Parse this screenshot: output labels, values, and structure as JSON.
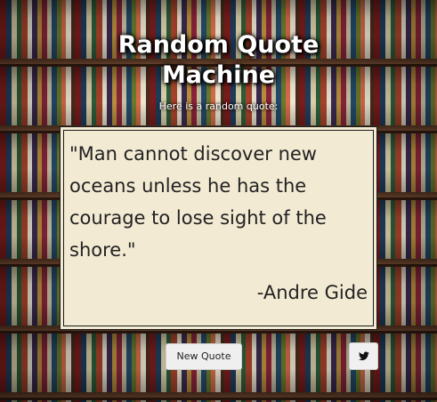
{
  "app": {
    "title_line1": "Random Quote",
    "title_line2": "Machine",
    "subtitle": "Here is a random quote:"
  },
  "quote": {
    "text": "\"Man cannot discover new oceans unless he has the courage to lose sight of the shore.\"",
    "author": "-Andre Gide"
  },
  "actions": {
    "new_quote_label": "New Quote",
    "tweet_icon": "twitter-bird-icon"
  },
  "colors": {
    "quote_box_bg": "#f3ead3",
    "text_dark": "#222222",
    "title_text": "#ffffff"
  }
}
